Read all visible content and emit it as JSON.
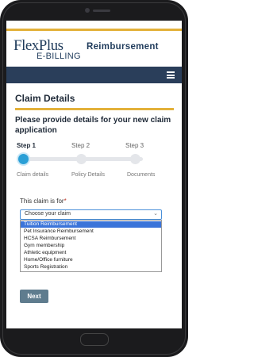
{
  "header": {
    "logo_main": "FlexPlus",
    "logo_sub": "E-BILLING",
    "title": "Reimbursement"
  },
  "navbar": {
    "menu_icon": "hamburger-menu-icon"
  },
  "main": {
    "section_title": "Claim Details",
    "intro": "Please provide details for your new claim application",
    "steps": [
      {
        "label": "Step 1",
        "caption": "Claim details",
        "active": true
      },
      {
        "label": "Step 2",
        "caption": "Policy Details",
        "active": false
      },
      {
        "label": "Step 3",
        "caption": "Documents",
        "active": false
      }
    ],
    "claim_field": {
      "label": "This claim is for",
      "required_mark": "*",
      "selected_value": "Choose your claim",
      "options": [
        "Tuition Reimbursement",
        "Pet Insurance Reimbursement",
        "HCSA Reimbursement",
        "Gym membership",
        "Athletic equipment",
        "Home/Office furniture",
        "Sports Registration"
      ],
      "highlighted_option": 0
    },
    "next_label": "Next"
  },
  "colors": {
    "brand_navy": "#2a3e5a",
    "accent_gold": "#e3b13a",
    "step_active": "#2a9fd6",
    "option_highlight": "#3b74d9",
    "button": "#5f7c8e"
  }
}
